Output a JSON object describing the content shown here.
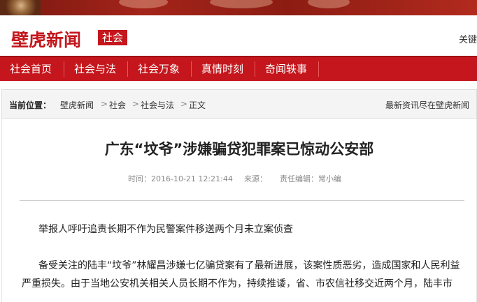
{
  "brand": {
    "logo": "壁虎新闻",
    "section_tag": "社会",
    "keyword_label": "关键"
  },
  "nav": {
    "items": [
      "社会首页",
      "社会与法",
      "社会万象",
      "真情时刻",
      "奇闻轶事"
    ]
  },
  "breadcrumb": {
    "label": "当前位置：",
    "items": [
      "壁虎新闻",
      "社会",
      "社会与法",
      "正文"
    ],
    "separator": ">",
    "right_text": "最新资讯尽在壁虎新闻"
  },
  "article": {
    "title": "广东“坟爷”涉嫌骗贷犯罪案已惊动公安部",
    "time": "时间：2016-10-21 12:21:44",
    "source": "来源：",
    "editor": "责任编辑：常小编",
    "paragraphs": [
      "举报人呼吁追责长期不作为民警案件移送两个月未立案侦查",
      "备受关注的陆丰“坟爷”林耀昌涉嫌七亿骗贷案有了最新进展，该案性质恶劣，造成国家和人民利益严重损失。由于当地公安机关相关人员长期不作为，持续推诿，省、市农信社移交近两个月，陆丰市"
    ]
  },
  "colors": {
    "brand_red": "#c4161c",
    "nav_text": "#ffffff",
    "meta_gray": "#888888"
  }
}
